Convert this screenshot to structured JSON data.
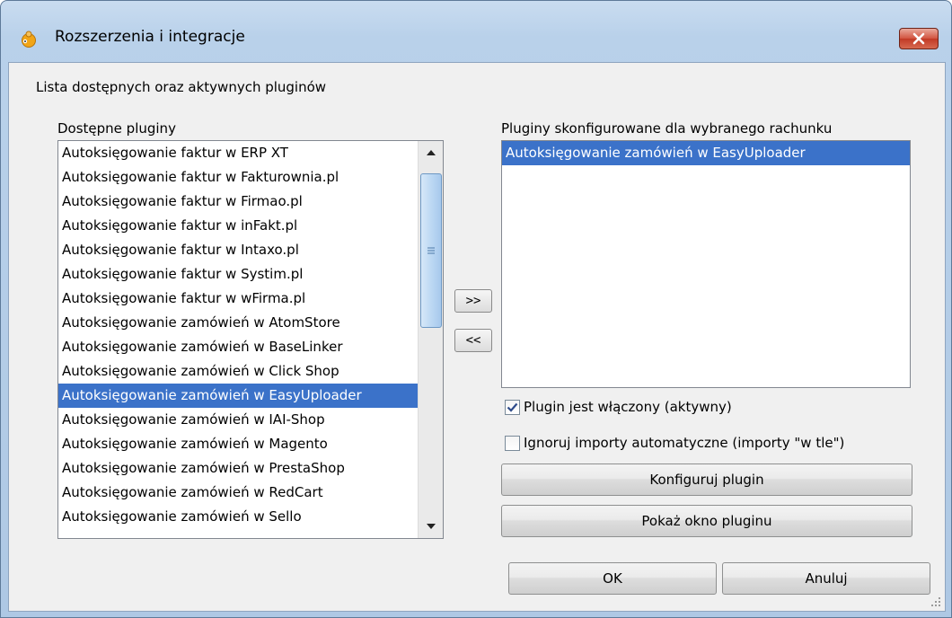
{
  "window": {
    "title": "Rozszerzenia i integracje"
  },
  "header": {
    "description": "Lista dostępnych oraz aktywnych pluginów"
  },
  "available": {
    "label": "Dostępne pluginy",
    "items": [
      "Autoksięgowanie faktur w ERP XT",
      "Autoksięgowanie faktur w Fakturownia.pl",
      "Autoksięgowanie faktur w Firmao.pl",
      "Autoksięgowanie faktur w inFakt.pl",
      "Autoksięgowanie faktur w Intaxo.pl",
      "Autoksięgowanie faktur w Systim.pl",
      "Autoksięgowanie faktur w wFirma.pl",
      "Autoksięgowanie zamówień w AtomStore",
      "Autoksięgowanie zamówień w BaseLinker",
      "Autoksięgowanie zamówień w Click Shop",
      "Autoksięgowanie zamówień w EasyUploader",
      "Autoksięgowanie zamówień w IAI-Shop",
      "Autoksięgowanie zamówień w Magento",
      "Autoksięgowanie zamówień w PrestaShop",
      "Autoksięgowanie zamówień w RedCart",
      "Autoksięgowanie zamówień w Sello"
    ],
    "selected_index": 10
  },
  "configured": {
    "label": "Pluginy skonfigurowane dla wybranego rachunku",
    "items": [
      "Autoksięgowanie zamówień w EasyUploader"
    ],
    "selected_index": 0
  },
  "buttons": {
    "add": ">>",
    "remove": "<<",
    "configure": "Konfiguruj plugin",
    "show_window": "Pokaż okno pluginu",
    "ok": "OK",
    "cancel": "Anuluj"
  },
  "options": {
    "enabled_label": "Plugin jest włączony (aktywny)",
    "enabled_checked": true,
    "ignore_label": "Ignoruj importy automatyczne (importy \"w tle\")",
    "ignore_checked": false
  },
  "colors": {
    "selection": "#3b72c9",
    "close_button": "#c23a26"
  }
}
